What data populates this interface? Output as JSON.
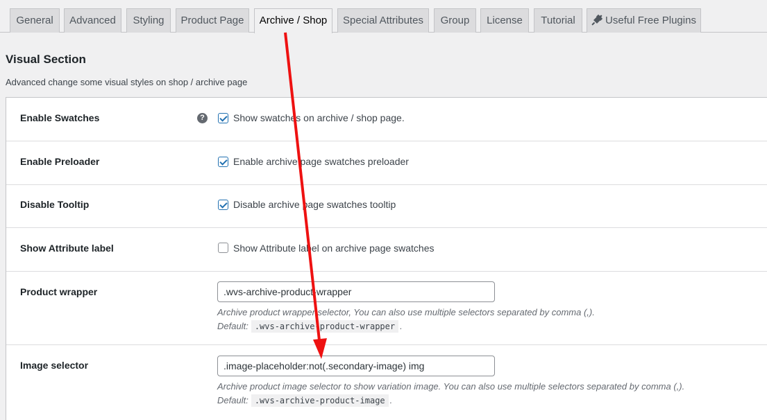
{
  "tabs": [
    {
      "label": "General"
    },
    {
      "label": "Advanced"
    },
    {
      "label": "Styling"
    },
    {
      "label": "Product Page"
    },
    {
      "label": "Archive / Shop",
      "active": true
    },
    {
      "label": "Special Attributes"
    },
    {
      "label": "Group"
    },
    {
      "label": "License"
    },
    {
      "label": "Tutorial"
    },
    {
      "label": "Useful Free Plugins",
      "icon": "plug-icon"
    }
  ],
  "section": {
    "title": "Visual Section",
    "description": "Advanced change some visual styles on shop / archive page"
  },
  "settings": {
    "enable_swatches": {
      "label": "Enable Swatches",
      "checkbox_label": "Show swatches on archive / shop page.",
      "checked": true,
      "help_icon": "question-icon"
    },
    "enable_preloader": {
      "label": "Enable Preloader",
      "checkbox_label": "Enable archive page swatches preloader",
      "checked": true
    },
    "disable_tooltip": {
      "label": "Disable Tooltip",
      "checkbox_label": "Disable archive page swatches tooltip",
      "checked": true
    },
    "show_attribute_label": {
      "label": "Show Attribute label",
      "checkbox_label": "Show Attribute label on archive page swatches",
      "checked": false
    },
    "product_wrapper": {
      "label": "Product wrapper",
      "value": ".wvs-archive-product-wrapper",
      "description": "Archive product wrapper selector, You can also use multiple selectors separated by comma (,).",
      "default_prefix": "Default:",
      "default_value": ".wvs-archive-product-wrapper",
      "default_suffix": "."
    },
    "image_selector": {
      "label": "Image selector",
      "value": ".image-placeholder:not(.secondary-image) img",
      "description": "Archive product image selector to show variation image. You can also use multiple selectors separated by comma (,).",
      "default_prefix": "Default:",
      "default_value": ".wvs-archive-product-image",
      "default_suffix": "."
    }
  },
  "annotation": {
    "color": "#ee1111"
  }
}
